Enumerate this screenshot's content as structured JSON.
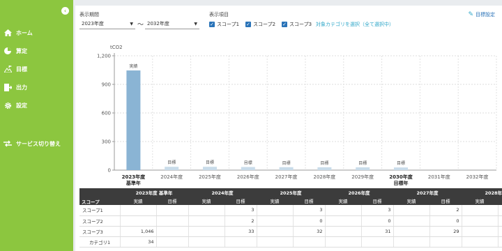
{
  "sidebar": {
    "collapse_icon": "chevron-left-icon",
    "items": [
      {
        "label": "ホーム",
        "icon": "home-icon"
      },
      {
        "label": "算定",
        "icon": "pie-chart-icon"
      },
      {
        "label": "目標",
        "icon": "mountain-flag-icon"
      },
      {
        "label": "出力",
        "icon": "export-icon"
      },
      {
        "label": "設定",
        "icon": "gear-icon"
      },
      {
        "label": "サービス切り替え",
        "icon": "switch-icon"
      }
    ],
    "color": "#8cc63f"
  },
  "filters": {
    "period_label": "表示期間",
    "start_year": "2023年度",
    "tilde": "〜",
    "end_year": "2032年度",
    "items_label": "表示項目",
    "scopes": [
      {
        "label": "スコープ1",
        "checked": true
      },
      {
        "label": "スコープ2",
        "checked": true
      },
      {
        "label": "スコープ3",
        "checked": true
      }
    ],
    "category_link": "対象カテゴリを選択（全て選択中）",
    "target_setting": "目標設定"
  },
  "chart_data": {
    "type": "bar",
    "ylabel": "tCO2",
    "ylim": [
      0,
      1200
    ],
    "yticks": [
      "0",
      "300",
      "600",
      "900",
      "1,200"
    ],
    "categories": [
      "2023年度",
      "2024年度",
      "2025年度",
      "2026年度",
      "2027年度",
      "2028年度",
      "2029年度",
      "2030年度",
      "2031年度",
      "2032年度"
    ],
    "category_sublabels": [
      "基準年",
      "",
      "",
      "",
      "",
      "",
      "",
      "目標年",
      "",
      ""
    ],
    "bold_categories": [
      0,
      7
    ],
    "values": [
      1046,
      35,
      35,
      33,
      31,
      30,
      29,
      28,
      null,
      null
    ],
    "bar_labels": [
      "実績",
      "目標",
      "目標",
      "目標",
      "目標",
      "目標",
      "目標",
      "目標",
      "",
      ""
    ],
    "colors": {
      "actual": "#8ab4d4",
      "target": "#c9dcea"
    },
    "grid": true
  },
  "table": {
    "scope_header": "スコープ",
    "years": [
      "2023年度 基準年",
      "2024年度",
      "2025年度",
      "2026年度",
      "2027年度",
      "2028年度"
    ],
    "sub_headers": [
      "実績",
      "目標"
    ],
    "rows": [
      {
        "label": "スコープ1",
        "cells": [
          "",
          "",
          "",
          "3",
          "",
          "3",
          "",
          "3",
          "",
          "2",
          "",
          ""
        ]
      },
      {
        "label": "スコープ2",
        "cells": [
          "",
          "",
          "",
          "2",
          "",
          "0",
          "",
          "0",
          "",
          "0",
          "",
          ""
        ]
      },
      {
        "label": "スコープ3",
        "cells": [
          "1,046",
          "",
          "",
          "33",
          "",
          "32",
          "",
          "31",
          "",
          "29",
          "",
          ""
        ]
      },
      {
        "label": "カテゴリ1",
        "cells": [
          "34",
          "",
          "",
          "",
          "",
          "",
          "",
          "",
          "",
          "",
          "",
          ""
        ],
        "sub": true
      }
    ]
  }
}
